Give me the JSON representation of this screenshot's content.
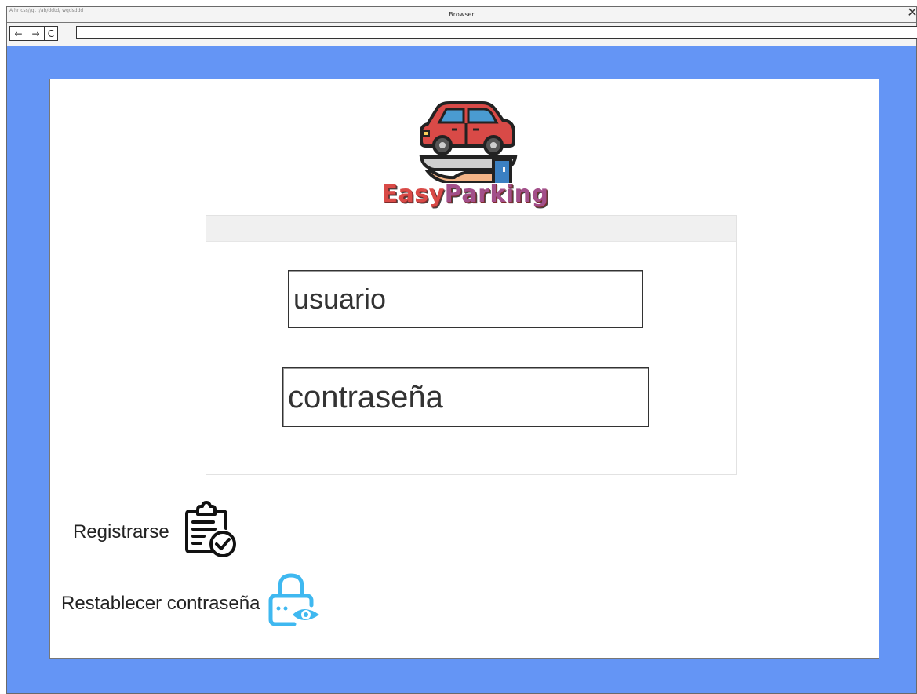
{
  "browser": {
    "title": "Browser",
    "tiny_url": "A hr css//gt :/ab/ddtd/ wqdsddd",
    "back_icon": "←",
    "forward_icon": "→",
    "reload_icon": "C",
    "close_icon": "✕",
    "address_value": ""
  },
  "logo": {
    "word_part1": "Easy",
    "word_part2": "Parking",
    "colors": {
      "car": "#d94a47",
      "hand": "#f4b487",
      "cuff": "#3b80c2",
      "tray": "#cfcfcf"
    }
  },
  "login": {
    "username_placeholder": "usuario",
    "password_placeholder": "contraseña"
  },
  "actions": {
    "register_label": "Registrarse",
    "register_icon": "clipboard-check-icon",
    "reset_label": "Restablecer contraseña",
    "reset_icon": "lock-eye-icon"
  },
  "colors": {
    "background": "#6495f5",
    "card": "#ffffff",
    "reset_icon": "#3fb8f0"
  }
}
